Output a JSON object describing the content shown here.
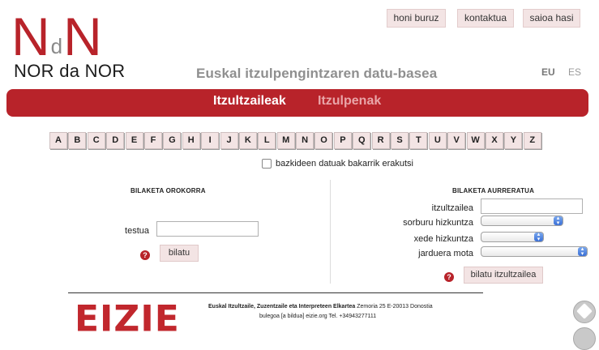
{
  "logo": {
    "letter_left": "N",
    "letter_mid": "d",
    "letter_right": "N",
    "subtitle": "NOR da NOR"
  },
  "header": {
    "buttons": [
      "honi buruz",
      "kontaktua",
      "saioa hasi"
    ],
    "tagline": "Euskal itzulpengintzaren datu-basea",
    "languages": [
      "EU",
      "ES"
    ]
  },
  "nav": {
    "tabs": [
      "Itzultzaileak",
      "Itzulpenak"
    ]
  },
  "alphabet": [
    "A",
    "B",
    "C",
    "D",
    "E",
    "F",
    "G",
    "H",
    "I",
    "J",
    "K",
    "L",
    "M",
    "N",
    "O",
    "P",
    "Q",
    "R",
    "S",
    "T",
    "U",
    "V",
    "W",
    "X",
    "Y",
    "Z"
  ],
  "filter": {
    "members_only_label": "bazkideen datuak bakarrik erakutsi"
  },
  "basic_search": {
    "title": "BILAKETA OROKORRA",
    "text_label": "testua",
    "text_value": "",
    "help_symbol": "?",
    "submit_label": "bilatu"
  },
  "advanced_search": {
    "title": "BILAKETA AURRERATUA",
    "fields": [
      {
        "label": "itzultzailea",
        "value": ""
      },
      {
        "label": "sorburu hizkuntza",
        "value": ""
      },
      {
        "label": "xede hizkuntza",
        "value": ""
      },
      {
        "label": "jarduera mota",
        "value": ""
      }
    ],
    "help_symbol": "?",
    "submit_label": "bilatu itzultzailea"
  },
  "footer": {
    "org_logo": "EIZIE",
    "org_name": "Euskal Itzultzaile, Zuzentzaile eta Interpreteen Elkartea",
    "address": "Zemoria 25 E-20013 Donostia",
    "contact": "bulegoa [a bildua] eizie.org Tel. +34943277111"
  },
  "colors": {
    "brand_red": "#b8232a",
    "button_pink": "#f3e4e4",
    "tagline_gray": "#8f8f8f"
  }
}
